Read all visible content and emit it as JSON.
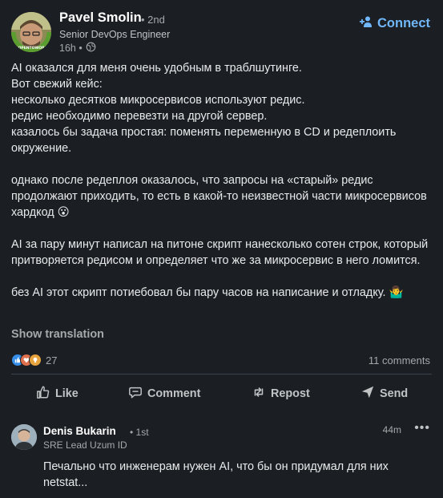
{
  "post": {
    "author": {
      "name": "Pavel Smolin",
      "degree": "• 2nd",
      "title": "Senior DevOps Engineer",
      "time": "16h •",
      "visibility_icon": "globe-icon",
      "avatar_badge": "#OPENTOWORK"
    },
    "connect_label": "Connect",
    "paragraphs": [
      "AI оказался для меня очень удобным в траблшутинге.\nВот свежий кейс:\nнесколько десятков микросервисов используют редис.\nредис необходимо перевезти на другой сервер.\nказалось бы задача простая: поменять переменную в CD и редеплоить окружение.",
      "однако после редеплоя оказалось, что запросы на «старый» редис продолжают приходить, то есть в какой-то неизвестной части микросервисов хардкод 😮",
      "AI за пару минут написал на питоне скрипт нанесколько сотен строк, который притворяется редисом и определяет что же за микросервис в него ломится.",
      "без AI этот скрипт потиебовал бы пару часов на написание и отладку. 🤷‍♂️"
    ],
    "show_translation": "Show translation",
    "reactions_count": "27",
    "comments_count": "11 comments"
  },
  "actions": {
    "like": "Like",
    "comment": "Comment",
    "repost": "Repost",
    "send": "Send"
  },
  "comment": {
    "name": "Denis Bukarin",
    "degree": "• 1st",
    "title": "SRE Lead Uzum ID",
    "time": "44m",
    "text": "Печально что инженерам нужен AI, что бы он придумал для них netstat..."
  },
  "colors": {
    "background": "#1b1f23",
    "accent": "#71b7fb",
    "text_primary": "#e8e9ea",
    "text_secondary": "#a6a8aa",
    "open_to_work": "#5a9e2f"
  }
}
